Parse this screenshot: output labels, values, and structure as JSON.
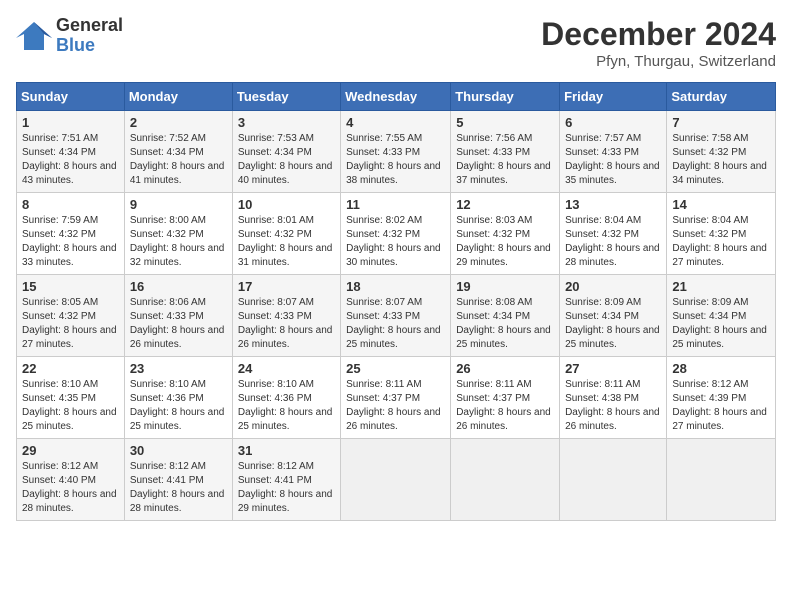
{
  "header": {
    "logo": {
      "line1": "General",
      "line2": "Blue"
    },
    "title": "December 2024",
    "location": "Pfyn, Thurgau, Switzerland"
  },
  "days_of_week": [
    "Sunday",
    "Monday",
    "Tuesday",
    "Wednesday",
    "Thursday",
    "Friday",
    "Saturday"
  ],
  "weeks": [
    [
      {
        "day": "1",
        "sunrise": "Sunrise: 7:51 AM",
        "sunset": "Sunset: 4:34 PM",
        "daylight": "Daylight: 8 hours and 43 minutes."
      },
      {
        "day": "2",
        "sunrise": "Sunrise: 7:52 AM",
        "sunset": "Sunset: 4:34 PM",
        "daylight": "Daylight: 8 hours and 41 minutes."
      },
      {
        "day": "3",
        "sunrise": "Sunrise: 7:53 AM",
        "sunset": "Sunset: 4:34 PM",
        "daylight": "Daylight: 8 hours and 40 minutes."
      },
      {
        "day": "4",
        "sunrise": "Sunrise: 7:55 AM",
        "sunset": "Sunset: 4:33 PM",
        "daylight": "Daylight: 8 hours and 38 minutes."
      },
      {
        "day": "5",
        "sunrise": "Sunrise: 7:56 AM",
        "sunset": "Sunset: 4:33 PM",
        "daylight": "Daylight: 8 hours and 37 minutes."
      },
      {
        "day": "6",
        "sunrise": "Sunrise: 7:57 AM",
        "sunset": "Sunset: 4:33 PM",
        "daylight": "Daylight: 8 hours and 35 minutes."
      },
      {
        "day": "7",
        "sunrise": "Sunrise: 7:58 AM",
        "sunset": "Sunset: 4:32 PM",
        "daylight": "Daylight: 8 hours and 34 minutes."
      }
    ],
    [
      {
        "day": "8",
        "sunrise": "Sunrise: 7:59 AM",
        "sunset": "Sunset: 4:32 PM",
        "daylight": "Daylight: 8 hours and 33 minutes."
      },
      {
        "day": "9",
        "sunrise": "Sunrise: 8:00 AM",
        "sunset": "Sunset: 4:32 PM",
        "daylight": "Daylight: 8 hours and 32 minutes."
      },
      {
        "day": "10",
        "sunrise": "Sunrise: 8:01 AM",
        "sunset": "Sunset: 4:32 PM",
        "daylight": "Daylight: 8 hours and 31 minutes."
      },
      {
        "day": "11",
        "sunrise": "Sunrise: 8:02 AM",
        "sunset": "Sunset: 4:32 PM",
        "daylight": "Daylight: 8 hours and 30 minutes."
      },
      {
        "day": "12",
        "sunrise": "Sunrise: 8:03 AM",
        "sunset": "Sunset: 4:32 PM",
        "daylight": "Daylight: 8 hours and 29 minutes."
      },
      {
        "day": "13",
        "sunrise": "Sunrise: 8:04 AM",
        "sunset": "Sunset: 4:32 PM",
        "daylight": "Daylight: 8 hours and 28 minutes."
      },
      {
        "day": "14",
        "sunrise": "Sunrise: 8:04 AM",
        "sunset": "Sunset: 4:32 PM",
        "daylight": "Daylight: 8 hours and 27 minutes."
      }
    ],
    [
      {
        "day": "15",
        "sunrise": "Sunrise: 8:05 AM",
        "sunset": "Sunset: 4:32 PM",
        "daylight": "Daylight: 8 hours and 27 minutes."
      },
      {
        "day": "16",
        "sunrise": "Sunrise: 8:06 AM",
        "sunset": "Sunset: 4:33 PM",
        "daylight": "Daylight: 8 hours and 26 minutes."
      },
      {
        "day": "17",
        "sunrise": "Sunrise: 8:07 AM",
        "sunset": "Sunset: 4:33 PM",
        "daylight": "Daylight: 8 hours and 26 minutes."
      },
      {
        "day": "18",
        "sunrise": "Sunrise: 8:07 AM",
        "sunset": "Sunset: 4:33 PM",
        "daylight": "Daylight: 8 hours and 25 minutes."
      },
      {
        "day": "19",
        "sunrise": "Sunrise: 8:08 AM",
        "sunset": "Sunset: 4:34 PM",
        "daylight": "Daylight: 8 hours and 25 minutes."
      },
      {
        "day": "20",
        "sunrise": "Sunrise: 8:09 AM",
        "sunset": "Sunset: 4:34 PM",
        "daylight": "Daylight: 8 hours and 25 minutes."
      },
      {
        "day": "21",
        "sunrise": "Sunrise: 8:09 AM",
        "sunset": "Sunset: 4:34 PM",
        "daylight": "Daylight: 8 hours and 25 minutes."
      }
    ],
    [
      {
        "day": "22",
        "sunrise": "Sunrise: 8:10 AM",
        "sunset": "Sunset: 4:35 PM",
        "daylight": "Daylight: 8 hours and 25 minutes."
      },
      {
        "day": "23",
        "sunrise": "Sunrise: 8:10 AM",
        "sunset": "Sunset: 4:36 PM",
        "daylight": "Daylight: 8 hours and 25 minutes."
      },
      {
        "day": "24",
        "sunrise": "Sunrise: 8:10 AM",
        "sunset": "Sunset: 4:36 PM",
        "daylight": "Daylight: 8 hours and 25 minutes."
      },
      {
        "day": "25",
        "sunrise": "Sunrise: 8:11 AM",
        "sunset": "Sunset: 4:37 PM",
        "daylight": "Daylight: 8 hours and 26 minutes."
      },
      {
        "day": "26",
        "sunrise": "Sunrise: 8:11 AM",
        "sunset": "Sunset: 4:37 PM",
        "daylight": "Daylight: 8 hours and 26 minutes."
      },
      {
        "day": "27",
        "sunrise": "Sunrise: 8:11 AM",
        "sunset": "Sunset: 4:38 PM",
        "daylight": "Daylight: 8 hours and 26 minutes."
      },
      {
        "day": "28",
        "sunrise": "Sunrise: 8:12 AM",
        "sunset": "Sunset: 4:39 PM",
        "daylight": "Daylight: 8 hours and 27 minutes."
      }
    ],
    [
      {
        "day": "29",
        "sunrise": "Sunrise: 8:12 AM",
        "sunset": "Sunset: 4:40 PM",
        "daylight": "Daylight: 8 hours and 28 minutes."
      },
      {
        "day": "30",
        "sunrise": "Sunrise: 8:12 AM",
        "sunset": "Sunset: 4:41 PM",
        "daylight": "Daylight: 8 hours and 28 minutes."
      },
      {
        "day": "31",
        "sunrise": "Sunrise: 8:12 AM",
        "sunset": "Sunset: 4:41 PM",
        "daylight": "Daylight: 8 hours and 29 minutes."
      },
      null,
      null,
      null,
      null
    ]
  ]
}
